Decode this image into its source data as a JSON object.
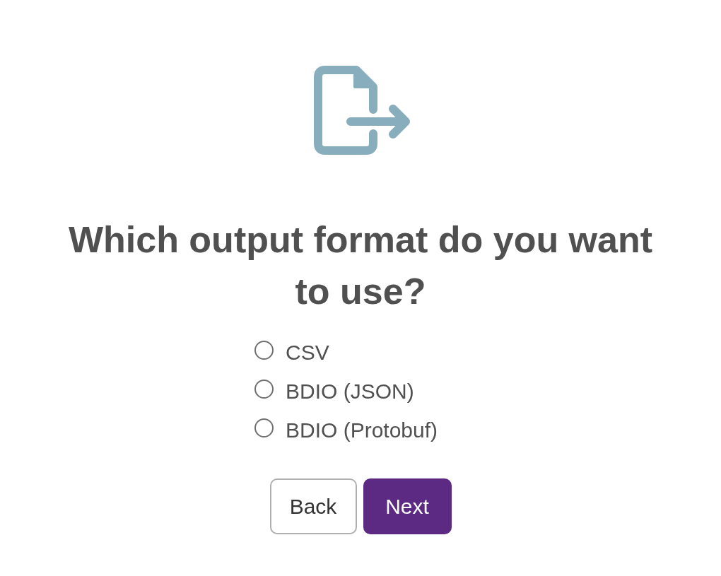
{
  "heading": "Which output format do you want to use?",
  "options": [
    {
      "label": "CSV",
      "selected": false
    },
    {
      "label": "BDIO (JSON)",
      "selected": false
    },
    {
      "label": "BDIO (Protobuf)",
      "selected": false
    }
  ],
  "buttons": [
    {
      "label": "Back",
      "kind": "secondary"
    },
    {
      "label": "Next",
      "kind": "primary"
    }
  ]
}
